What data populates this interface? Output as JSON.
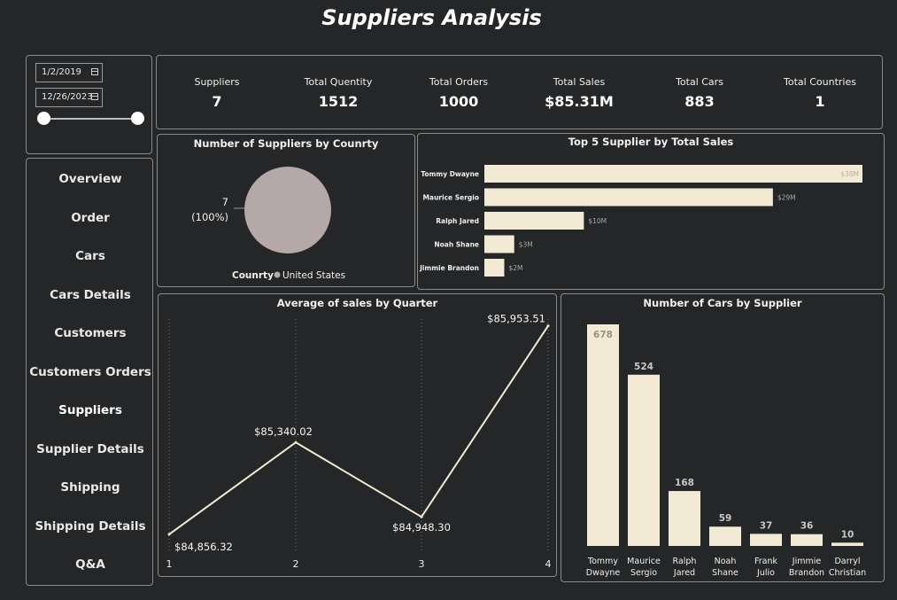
{
  "page": {
    "title": "Suppliers Analysis"
  },
  "filters": {
    "start_date": "1/2/2019",
    "end_date": "12/26/2023"
  },
  "nav": {
    "items": [
      {
        "label": "Overview"
      },
      {
        "label": "Order"
      },
      {
        "label": "Cars"
      },
      {
        "label": "Cars Details"
      },
      {
        "label": "Customers"
      },
      {
        "label": "Customers Orders"
      },
      {
        "label": "Suppliers"
      },
      {
        "label": "Supplier Details"
      },
      {
        "label": "Shipping"
      },
      {
        "label": "Shipping Details"
      },
      {
        "label": "Q&A"
      }
    ],
    "active": "Suppliers"
  },
  "kpis": [
    {
      "label": "Suppliers",
      "value": "7"
    },
    {
      "label": "Total Quentity",
      "value": "1512"
    },
    {
      "label": "Total Orders",
      "value": "1000"
    },
    {
      "label": "Total Sales",
      "value": "$85.31M"
    },
    {
      "label": "Total Cars",
      "value": "883"
    },
    {
      "label": "Total Countries",
      "value": "1"
    }
  ],
  "colors": {
    "background": "#252627",
    "bar": "#f3ead5",
    "pie": "#b5a8a8",
    "line": "#f3ead5",
    "text": "#f2f2f2"
  },
  "chart_data": [
    {
      "id": "pie",
      "type": "pie",
      "title": "Number of Suppliers by Counrty",
      "legend_title": "Counrty",
      "slices": [
        {
          "name": "United States",
          "value": 7,
          "label_value": "7",
          "label_pct": "(100%)"
        }
      ]
    },
    {
      "id": "top5",
      "type": "bar",
      "orientation": "horizontal",
      "title": "Top 5 Supplier by Total Sales",
      "categories": [
        "Tommy Dwayne",
        "Maurice Sergio",
        "Ralph Jared",
        "Noah Shane",
        "Jimmie Brandon"
      ],
      "values": [
        38,
        29,
        10,
        3,
        2
      ],
      "data_labels": [
        "$38M",
        "$29M",
        "$10M",
        "$3M",
        "$2M"
      ]
    },
    {
      "id": "quarter",
      "type": "line",
      "title": "Average of sales by Quarter",
      "x": [
        "1",
        "2",
        "3",
        "4"
      ],
      "values": [
        84856.32,
        85340.02,
        84948.3,
        85953.51
      ],
      "data_labels": [
        "$84,856.32",
        "$85,340.02",
        "$84,948.30",
        "$85,953.51"
      ]
    },
    {
      "id": "cars",
      "type": "bar",
      "orientation": "vertical",
      "title": "Number of Cars by Supplier",
      "categories": [
        [
          "Tommy",
          "Dwayne"
        ],
        [
          "Maurice",
          "Sergio"
        ],
        [
          "Ralph",
          "Jared"
        ],
        [
          "Noah",
          "Shane"
        ],
        [
          "Frank",
          "Julio"
        ],
        [
          "Jimmie",
          "Brandon"
        ],
        [
          "Darryl",
          "Christian"
        ]
      ],
      "values": [
        678,
        524,
        168,
        59,
        37,
        36,
        10
      ],
      "data_labels": [
        "678",
        "524",
        "168",
        "59",
        "37",
        "36",
        "10"
      ]
    }
  ]
}
